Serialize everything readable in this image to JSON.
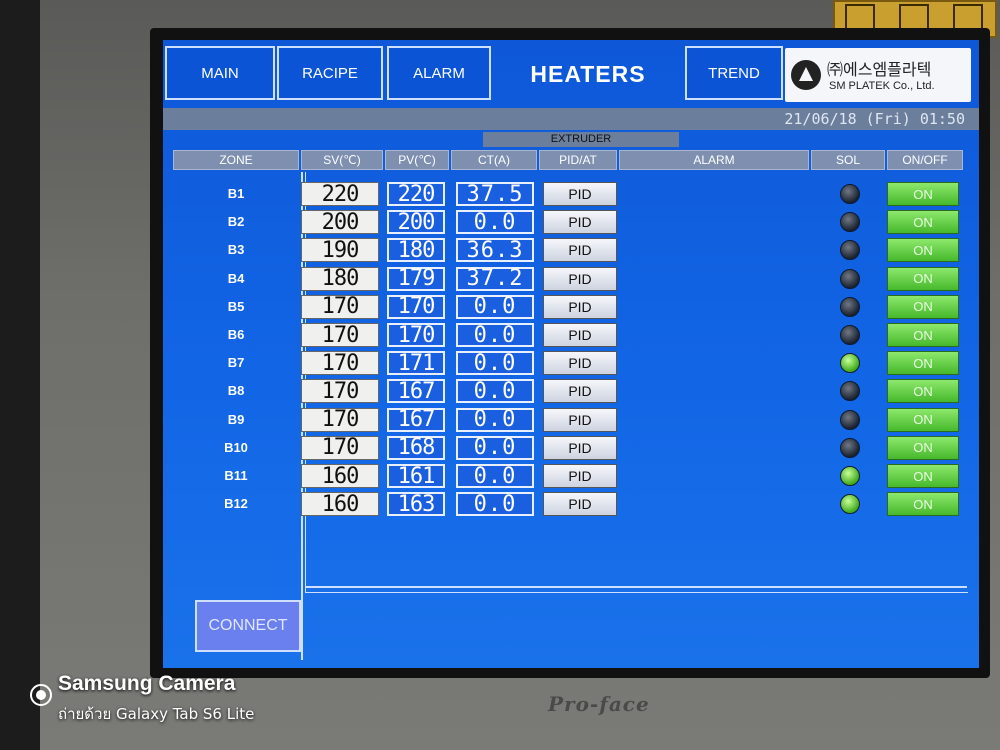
{
  "nav": {
    "main": "MAIN",
    "recipe": "RACIPE",
    "alarm": "ALARM",
    "trend": "TREND"
  },
  "page_title": "HEATERS",
  "company": {
    "name_kr": "㈜에스엠플라텍",
    "name_en": "SM PLATEK Co., Ltd."
  },
  "datetime": "21/06/18 (Fri) 01:50",
  "section": "EXTRUDER",
  "columns": {
    "zone": "ZONE",
    "sv": "SV(℃)",
    "pv": "PV(℃)",
    "ct": "CT(A)",
    "pid_at": "PID/AT",
    "alarm": "ALARM",
    "sol": "SOL",
    "on_off": "ON/OFF"
  },
  "rows": [
    {
      "zone": "B1",
      "sv": "220",
      "pv": "220",
      "ct": "37.5",
      "mode": "PID",
      "sol": "off",
      "state": "ON"
    },
    {
      "zone": "B2",
      "sv": "200",
      "pv": "200",
      "ct": "0.0",
      "mode": "PID",
      "sol": "off",
      "state": "ON"
    },
    {
      "zone": "B3",
      "sv": "190",
      "pv": "180",
      "ct": "36.3",
      "mode": "PID",
      "sol": "off",
      "state": "ON"
    },
    {
      "zone": "B4",
      "sv": "180",
      "pv": "179",
      "ct": "37.2",
      "mode": "PID",
      "sol": "off",
      "state": "ON"
    },
    {
      "zone": "B5",
      "sv": "170",
      "pv": "170",
      "ct": "0.0",
      "mode": "PID",
      "sol": "off",
      "state": "ON"
    },
    {
      "zone": "B6",
      "sv": "170",
      "pv": "170",
      "ct": "0.0",
      "mode": "PID",
      "sol": "off",
      "state": "ON"
    },
    {
      "zone": "B7",
      "sv": "170",
      "pv": "171",
      "ct": "0.0",
      "mode": "PID",
      "sol": "on",
      "state": "ON"
    },
    {
      "zone": "B8",
      "sv": "170",
      "pv": "167",
      "ct": "0.0",
      "mode": "PID",
      "sol": "off",
      "state": "ON"
    },
    {
      "zone": "B9",
      "sv": "170",
      "pv": "167",
      "ct": "0.0",
      "mode": "PID",
      "sol": "off",
      "state": "ON"
    },
    {
      "zone": "B10",
      "sv": "170",
      "pv": "168",
      "ct": "0.0",
      "mode": "PID",
      "sol": "off",
      "state": "ON"
    },
    {
      "zone": "B11",
      "sv": "160",
      "pv": "161",
      "ct": "0.0",
      "mode": "PID",
      "sol": "on",
      "state": "ON"
    },
    {
      "zone": "B12",
      "sv": "160",
      "pv": "163",
      "ct": "0.0",
      "mode": "PID",
      "sol": "on",
      "state": "ON"
    }
  ],
  "connect_label": "CONNECT",
  "device_brand": "Pro-face",
  "camera": {
    "title": "Samsung Camera",
    "subtitle": "ถ่ายด้วย Galaxy Tab S6 Lite"
  },
  "colors": {
    "screen_bg": "#1266e6",
    "sol_on": "#3faa1a",
    "onoff_bg": "#46b82c"
  }
}
